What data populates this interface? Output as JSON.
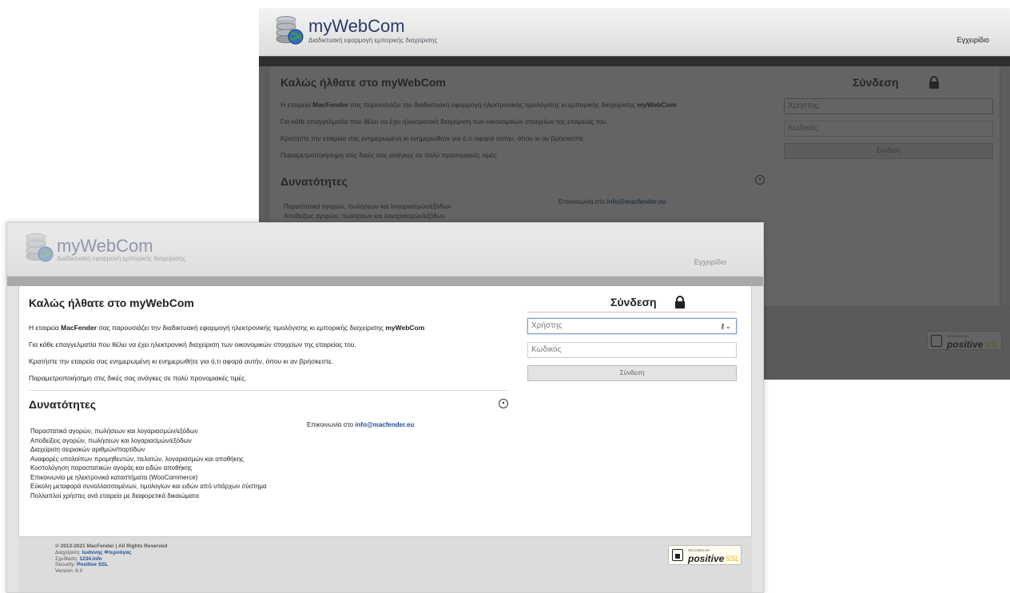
{
  "app": {
    "brand": "myWebCom",
    "tagline": "Διαδικτυακή εφαρμογή εμπορικής διαχείρισης",
    "manual_link": "Εγχειρίδιο"
  },
  "main": {
    "welcome_title": "Καλώς ήλθατε στο myWebCom",
    "intro": {
      "p1_prefix": "Η εταιρεία ",
      "p1_company": "MacFender",
      "p1_middle": " σας παρουσιάζει την διαδικτυακή εφαρμογή ηλεκτρονικής τιμολόγισης κι εμπορικής διαχείρισης ",
      "p1_app": "myWebCom",
      "p2": "Για κάθε επαγγελματία που θέλει να έχει ηλεκτρονική διαχείριση των οικονομικών στοιχείων της εταιρείας του.",
      "p3": "Κρατήστε την εταιρεία σας ενημερωμένη κι ενημερωθήτε για ό,τι αφορά αυτήν, όπου κι αν βρήσκεστε.",
      "p4": "Παραμετροποιήσημη στις δικές σας ανάγκες σε πολύ προνομιακές τιμές."
    },
    "features_title": "Δυνατότητες",
    "features": [
      "Παραστατικά αγορών, πωλήσεων και λογαριασμών/εξόδων",
      "Αποδείξεις αγορών, πωλήσεων και λογαριασμών/εξόδων",
      "Διαχείριση σειριακών αριθμών/παρτίδων",
      "Αναφορές υπολοίπων προμηθευτών, πελατών, λογαριασμών και αποθήκης",
      "Κοστολόγηση παραστατικών αγοράς και ειδών αποθήκης",
      "Επικοινωνία με ηλεκτρονικά καταστήματα (WooCommerce)",
      "Εύκολη μεταφορά συναλλασσομένων, τιμολογίων και ειδών από υπάρχων σύστημα",
      "Πολλαπλοί χρήστες ανά εταιρεία με διαφορετικά δικαιώματα"
    ],
    "contact_prefix": "Επικοινωνία στο ",
    "contact_email": "info@macfender.eu"
  },
  "login": {
    "title": "Σύνδεση",
    "username_placeholder": "Χρήστης",
    "password_placeholder": "Κωδικός",
    "submit": "Σύνδεση"
  },
  "footer": {
    "copyright": "© 2013-2021 MacFender  |  All Rights Reserved",
    "management_label": "Διαχείριση: ",
    "management_value": "Ιωάννης Φτερούγας",
    "design_label": "Σχεδίαση: ",
    "design_value": "1234.info",
    "security_label": "Security: ",
    "security_value": "Positive SSL",
    "version": "Version: 6.0",
    "ssl_badge": {
      "secured": "SECURED BY",
      "positive": "positive",
      "ssl": "SSL"
    }
  },
  "colors": {
    "brand_blue": "#2a3a6b",
    "link_blue": "#1d4f99",
    "ssl_yellow": "#f0b400",
    "dim_overlay": "#5b5b5b"
  }
}
